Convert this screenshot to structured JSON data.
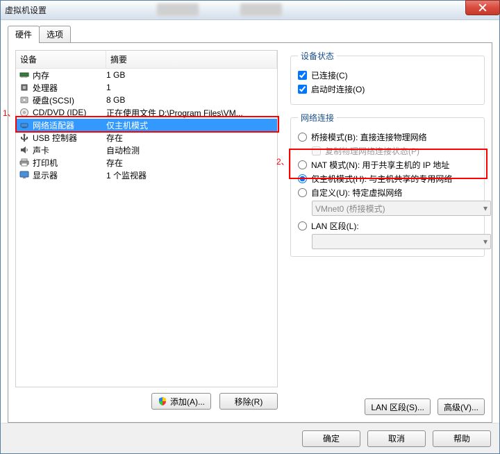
{
  "window": {
    "title": "虚拟机设置"
  },
  "tabs": {
    "hardware": "硬件",
    "options": "选项"
  },
  "columns": {
    "device": "设备",
    "summary": "摘要"
  },
  "devices": [
    {
      "icon": "memory-icon",
      "name": "内存",
      "summary": "1 GB"
    },
    {
      "icon": "cpu-icon",
      "name": "处理器",
      "summary": "1"
    },
    {
      "icon": "disk-icon",
      "name": "硬盘(SCSI)",
      "summary": "8 GB"
    },
    {
      "icon": "cd-icon",
      "name": "CD/DVD (IDE)",
      "summary": "正在使用文件 D:\\Program Files\\VM..."
    },
    {
      "icon": "network-icon",
      "name": "网络适配器",
      "summary": "仅主机模式"
    },
    {
      "icon": "usb-icon",
      "name": "USB 控制器",
      "summary": "存在"
    },
    {
      "icon": "sound-icon",
      "name": "声卡",
      "summary": "自动检测"
    },
    {
      "icon": "printer-icon",
      "name": "打印机",
      "summary": "存在"
    },
    {
      "icon": "display-icon",
      "name": "显示器",
      "summary": "1 个监视器"
    }
  ],
  "selected_index": 4,
  "buttons": {
    "add": "添加(A)...",
    "remove": "移除(R)",
    "lan": "LAN 区段(S)...",
    "advanced": "高级(V)..."
  },
  "status_group": {
    "legend": "设备状态",
    "connected": "已连接(C)",
    "connect_at_poweron": "启动时连接(O)"
  },
  "net_group": {
    "legend": "网络连接",
    "bridged": "桥接模式(B): 直接连接物理网络",
    "replicate": "复制物理网络连接状态(P)",
    "nat": "NAT 模式(N): 用于共享主机的 IP 地址",
    "hostonly": "仅主机模式(H): 与主机共享的专用网络",
    "custom": "自定义(U): 特定虚拟网络",
    "custom_value": "VMnet0 (桥接模式)",
    "lan_seg": "LAN 区段(L):"
  },
  "footer": {
    "ok": "确定",
    "cancel": "取消",
    "help": "帮助"
  },
  "annotations": {
    "one": "1、",
    "two": "2、"
  }
}
